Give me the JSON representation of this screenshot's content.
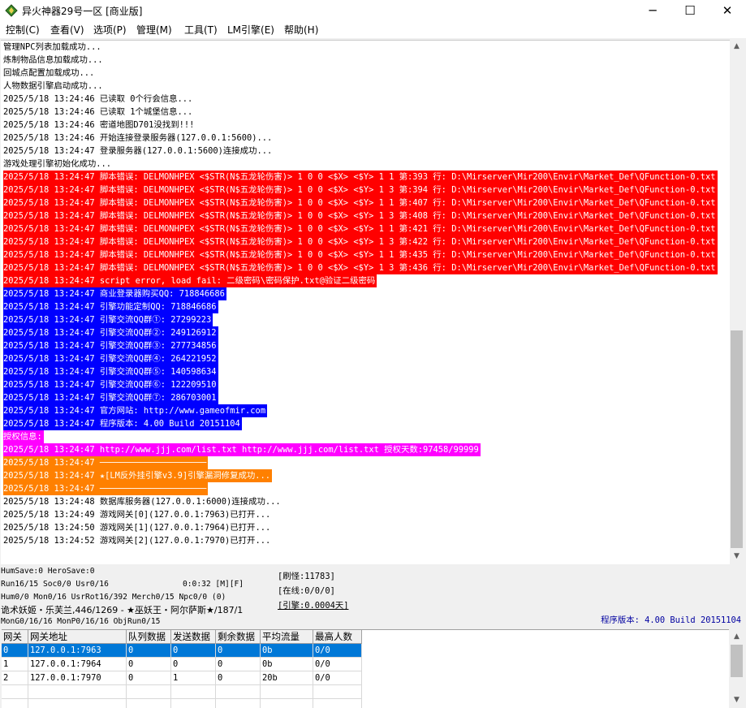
{
  "window": {
    "title": "异火神器29号一区 [商业版]",
    "minimize_glyph": "─",
    "maximize_glyph": "☐",
    "close_glyph": "✕",
    "icon": "green-diamond-app-icon"
  },
  "menu": [
    {
      "label": "控制(C)"
    },
    {
      "label": "查看(V)"
    },
    {
      "label": "选项(P)"
    },
    {
      "label": "管理(M)"
    },
    {
      "label": "工具(T)"
    },
    {
      "label": "LM引擎(E)"
    },
    {
      "label": "帮助(H)"
    }
  ],
  "log": [
    {
      "text": "管理NPC列表加载成功...",
      "color": "none"
    },
    {
      "text": "炼制物品信息加载成功...",
      "color": "none"
    },
    {
      "text": "回城点配置加载成功...",
      "color": "none"
    },
    {
      "text": "人物数据引擎启动成功...",
      "color": "none"
    },
    {
      "text": "2025/5/18 13:24:46 已读取 0个行会信息...",
      "color": "none"
    },
    {
      "text": "2025/5/18 13:24:46 已读取 1个城堡信息...",
      "color": "none"
    },
    {
      "text": "2025/5/18 13:24:46 密道地图D701没找到!!!",
      "color": "none"
    },
    {
      "text": "2025/5/18 13:24:46 开始连接登录服务器(127.0.0.1:5600)...",
      "color": "none"
    },
    {
      "text": "2025/5/18 13:24:47 登录服务器(127.0.0.1:5600)连接成功...",
      "color": "none"
    },
    {
      "text": "游戏处理引擎初始化成功...",
      "color": "none"
    },
    {
      "text": "2025/5/18 13:24:47 脚本错误: DELMONHPEX <$STR(N$五龙轮伤害)> 1 0 0 <$X> <$Y> 1 1 第:393 行: D:\\Mirserver\\Mir200\\Envir\\Market_Def\\QFunction-0.txt",
      "color": "red"
    },
    {
      "text": "2025/5/18 13:24:47 脚本错误: DELMONHPEX <$STR(N$五龙轮伤害)> 1 0 0 <$X> <$Y> 1 3 第:394 行: D:\\Mirserver\\Mir200\\Envir\\Market_Def\\QFunction-0.txt",
      "color": "red"
    },
    {
      "text": "2025/5/18 13:24:47 脚本错误: DELMONHPEX <$STR(N$五龙轮伤害)> 1 0 0 <$X> <$Y> 1 1 第:407 行: D:\\Mirserver\\Mir200\\Envir\\Market_Def\\QFunction-0.txt",
      "color": "red"
    },
    {
      "text": "2025/5/18 13:24:47 脚本错误: DELMONHPEX <$STR(N$五龙轮伤害)> 1 0 0 <$X> <$Y> 1 3 第:408 行: D:\\Mirserver\\Mir200\\Envir\\Market_Def\\QFunction-0.txt",
      "color": "red"
    },
    {
      "text": "2025/5/18 13:24:47 脚本错误: DELMONHPEX <$STR(N$五龙轮伤害)> 1 0 0 <$X> <$Y> 1 1 第:421 行: D:\\Mirserver\\Mir200\\Envir\\Market_Def\\QFunction-0.txt",
      "color": "red"
    },
    {
      "text": "2025/5/18 13:24:47 脚本错误: DELMONHPEX <$STR(N$五龙轮伤害)> 1 0 0 <$X> <$Y> 1 3 第:422 行: D:\\Mirserver\\Mir200\\Envir\\Market_Def\\QFunction-0.txt",
      "color": "red"
    },
    {
      "text": "2025/5/18 13:24:47 脚本错误: DELMONHPEX <$STR(N$五龙轮伤害)> 1 0 0 <$X> <$Y> 1 1 第:435 行: D:\\Mirserver\\Mir200\\Envir\\Market_Def\\QFunction-0.txt",
      "color": "red"
    },
    {
      "text": "2025/5/18 13:24:47 脚本错误: DELMONHPEX <$STR(N$五龙轮伤害)> 1 0 0 <$X> <$Y> 1 3 第:436 行: D:\\Mirserver\\Mir200\\Envir\\Market_Def\\QFunction-0.txt",
      "color": "red"
    },
    {
      "text": "2025/5/18 13:24:47 script error, load fail: 二级密码\\密码保护.txt@验证二级密码",
      "color": "red"
    },
    {
      "text": "2025/5/18 13:24:47 商业登录器购买QQ: 718846686",
      "color": "blue"
    },
    {
      "text": "2025/5/18 13:24:47 引擎功能定制QQ: 718846686",
      "color": "blue"
    },
    {
      "text": "2025/5/18 13:24:47 引擎交流QQ群①: 27299223",
      "color": "blue"
    },
    {
      "text": "2025/5/18 13:24:47 引擎交流QQ群②: 249126912",
      "color": "blue"
    },
    {
      "text": "2025/5/18 13:24:47 引擎交流QQ群③: 277734856",
      "color": "blue"
    },
    {
      "text": "2025/5/18 13:24:47 引擎交流QQ群④: 264221952",
      "color": "blue"
    },
    {
      "text": "2025/5/18 13:24:47 引擎交流QQ群⑤: 140598634",
      "color": "blue"
    },
    {
      "text": "2025/5/18 13:24:47 引擎交流QQ群⑥: 122209510",
      "color": "blue"
    },
    {
      "text": "2025/5/18 13:24:47 引擎交流QQ群⑦: 286703001",
      "color": "blue"
    },
    {
      "text": "2025/5/18 13:24:47 官方网站: http://www.gameofmir.com",
      "color": "blue"
    },
    {
      "text": "2025/5/18 13:24:47 程序版本: 4.00 Build 20151104",
      "color": "blue"
    },
    {
      "text": "授权信息:",
      "color": "magenta"
    },
    {
      "text": "2025/5/18 13:24:47 http://www.jjj.com/list.txt http://www.jjj.com/list.txt 授权天数:97458/99999",
      "color": "magenta"
    },
    {
      "text": "2025/5/18 13:24:47 ─────────────────────",
      "color": "orange"
    },
    {
      "text": "2025/5/18 13:24:47 ★[LM反外挂引擎v3.9]引擎漏洞修复成功...",
      "color": "orange"
    },
    {
      "text": "2025/5/18 13:24:47 ─────────────────────",
      "color": "orange"
    },
    {
      "text": "2025/5/18 13:24:48 数据库服务器(127.0.0.1:6000)连接成功...",
      "color": "none"
    },
    {
      "text": "2025/5/18 13:24:49 游戏网关[0](127.0.0.1:7963)已打开...",
      "color": "none"
    },
    {
      "text": "2025/5/18 13:24:50 游戏网关[1](127.0.0.1:7964)已打开...",
      "color": "none"
    },
    {
      "text": "2025/5/18 13:24:52 游戏网关[2](127.0.0.1:7970)已打开...",
      "color": "none"
    }
  ],
  "status": {
    "line1": "HumSave:0 HeroSave:0",
    "line2": "Run16/15 Soc0/0 Usr0/16",
    "timer": "0:0:32 [M][F]",
    "line3": "Hum0/0 Mon0/16 UsrRot16/392 Merch0/15 Npc0/0 (0)",
    "line4": "诡术妖姬・乐芙兰,446/1269 - ★巫妖王・阿尔萨斯★/187/1",
    "line5": "MonG0/16/16 MonP0/16/16 ObjRun0/15",
    "refresh": "[刷怪:11783]",
    "online": "[在线:0/0/0]",
    "engine": "[引擎:0.0004天]",
    "version": "程序版本: 4.00 Build 20151104"
  },
  "table": {
    "headers": [
      "网关",
      "网关地址",
      "队列数据",
      "发送数据",
      "剩余数据",
      "平均流量",
      "最高人数"
    ],
    "rows": [
      [
        "0",
        "127.0.0.1:7963",
        "0",
        "0",
        "0",
        "0b",
        "0/0"
      ],
      [
        "1",
        "127.0.0.1:7964",
        "0",
        "0",
        "0",
        "0b",
        "0/0"
      ],
      [
        "2",
        "127.0.0.1:7970",
        "0",
        "1",
        "0",
        "20b",
        "0/0"
      ]
    ],
    "selected_row": 0
  }
}
